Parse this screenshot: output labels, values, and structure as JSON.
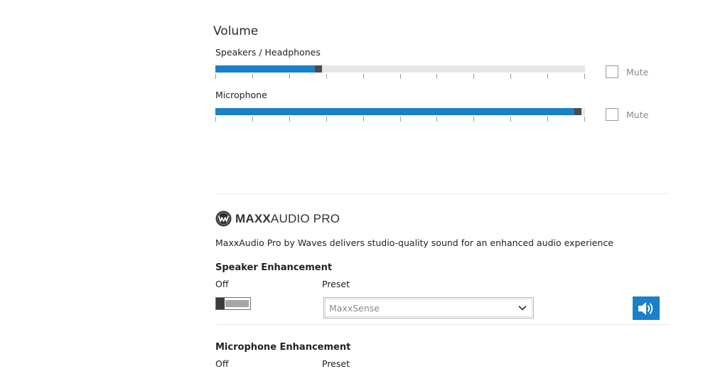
{
  "volume": {
    "title": "Volume",
    "speakers": {
      "label": "Speakers / Headphones",
      "level": 0.275,
      "mute_label": "Mute",
      "muted": false
    },
    "microphone": {
      "label": "Microphone",
      "level": 0.99,
      "mute_label": "Mute",
      "muted": false
    },
    "tick_count": 11
  },
  "maxx": {
    "brand_bold": "MAXX",
    "brand_light": "AUDIO PRO",
    "description": "MaxxAudio Pro by Waves delivers studio-quality sound for an enhanced audio experience",
    "speaker_enhancement": {
      "title": "Speaker Enhancement",
      "state_label": "Off",
      "preset_label": "Preset",
      "preset_value": "MaxxSense"
    },
    "microphone_enhancement": {
      "title": "Microphone Enhancement",
      "state_label": "Off",
      "preset_label": "Preset"
    }
  },
  "colors": {
    "accent": "#1a80c9",
    "thumb": "#4a4a4a",
    "track": "#e6e6e6"
  },
  "icons": {
    "speaker_test": "speaker-volume-icon",
    "dropdown": "chevron-down-icon",
    "logo": "waves-logo-icon"
  }
}
